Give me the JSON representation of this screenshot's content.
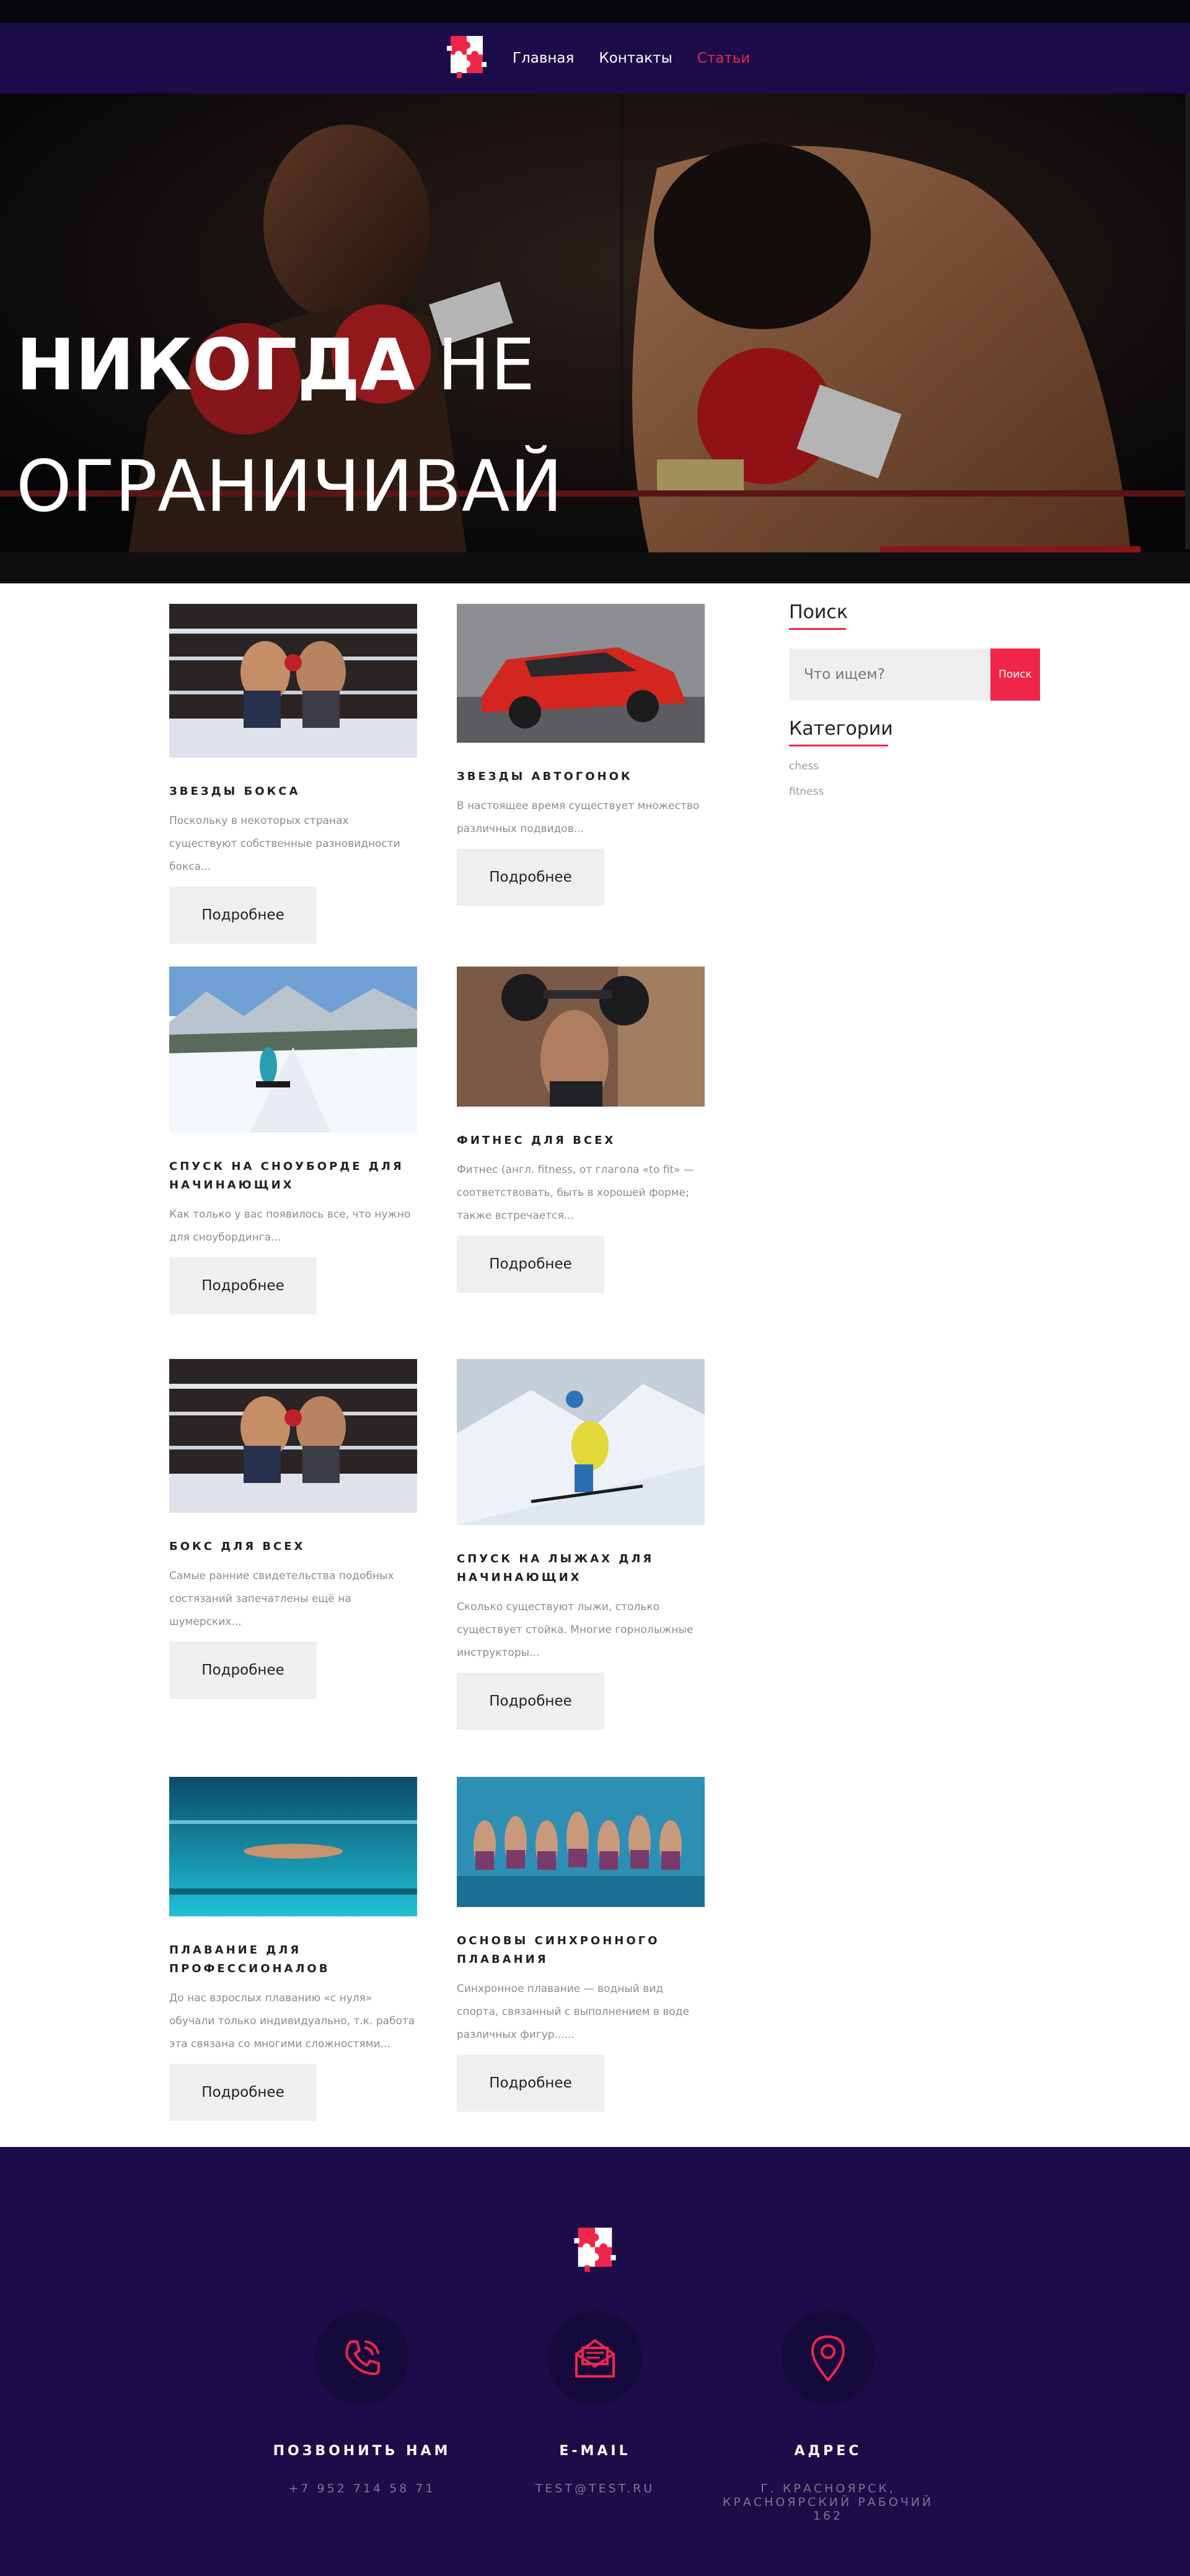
{
  "nav": {
    "links": [
      {
        "label": "Главная"
      },
      {
        "label": "Контакты"
      },
      {
        "label": "Статьи"
      }
    ]
  },
  "hero": {
    "title_bold": "НИКОГДА",
    "title_rest_line1": " НЕ",
    "title_line2": "ОГРАНИЧИВАЙ"
  },
  "articles": [
    {
      "title": "ЗВЕЗДЫ БОКСА",
      "excerpt": "Поскольку в некоторых странах существуют собственные разновидности бокса...",
      "button": "Подробнее",
      "image": "boxing-photo"
    },
    {
      "title": "ЗВЕЗДЫ АВТОГОНОК",
      "excerpt": "В настоящее время существует множество различных подвидов...",
      "button": "Подробнее",
      "image": "red-car-photo"
    },
    {
      "title": "СПУСК НА СНОУБОРДЕ ДЛЯ НАЧИНАЮЩИХ",
      "excerpt": "Как только у вас появилось все, что нужно для сноубординга...",
      "button": "Подробнее",
      "image": "snowboard-photo"
    },
    {
      "title": "ФИТНЕС ДЛЯ ВСЕХ",
      "excerpt": "Фитнес (англ. fitness, от глагола «to fit» — соответствовать, быть в хорошей форме; также встречается...",
      "button": "Подробнее",
      "image": "fitness-photo"
    },
    {
      "title": "БОКС ДЛЯ ВСЕХ",
      "excerpt": "Самые ранние свидетельства подобных состязаний запечатлены ещё на шумерских...",
      "button": "Подробнее",
      "image": "boxing-photo"
    },
    {
      "title": "СПУСК НА ЛЫЖАХ ДЛЯ НАЧИНАЮЩИХ",
      "excerpt": "Сколько существуют лыжи, столько существует стойка. Многие горнолыжные инструкторы...",
      "button": "Подробнее",
      "image": "ski-photo"
    },
    {
      "title": "ПЛАВАНИЕ ДЛЯ ПРОФЕССИОНАЛОВ",
      "excerpt": "До нас взрослых плаванию «с нуля» обучали только индивидуально, т.к. работа эта связана со многими сложностями...",
      "button": "Подробнее",
      "image": "swimming-photo"
    },
    {
      "title": "ОСНОВЫ СИНХРОННОГО ПЛАВАНИЯ",
      "excerpt": "Синхронное плавание — водный вид спорта, связанный с выполнением в воде различных фигур......",
      "button": "Подробнее",
      "image": "synchro-swimming-photo"
    }
  ],
  "sidebar": {
    "search_title": "Поиск",
    "search_placeholder": "Что ищем?",
    "search_button": "Поиск",
    "categories_title": "Категории",
    "categories": [
      "chess",
      "fitness"
    ]
  },
  "footer": {
    "contacts": [
      {
        "label": "ПОЗВОНИТЬ НАМ",
        "value": "+7 952 714 58 71",
        "icon": "phone-icon"
      },
      {
        "label": "E-MAIL",
        "value": "TEST@TEST.RU",
        "icon": "mail-icon"
      },
      {
        "label": "АДРЕС",
        "value": "Г. КРАСНОЯРСК, КРАСНОЯРСКИЙ РАБОЧИЙ 162",
        "icon": "location-icon"
      }
    ]
  },
  "colors": {
    "navy": "#1b0d49",
    "accent": "#f0254a",
    "button_bg": "#efefef"
  }
}
